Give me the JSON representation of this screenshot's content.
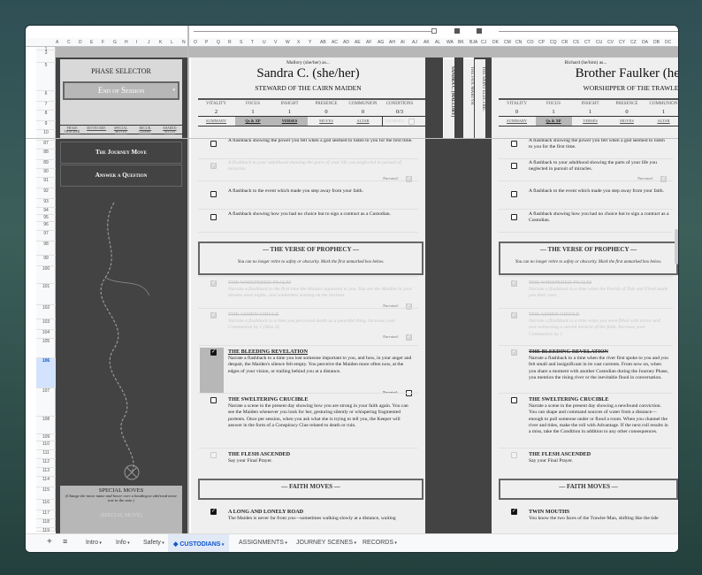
{
  "columns": [
    "A",
    "C",
    "D",
    "E",
    "F",
    "G",
    "H",
    "I",
    "J",
    "K",
    "L",
    "N",
    "O",
    "P",
    "Q",
    "R",
    "S",
    "T",
    "U",
    "V",
    "W",
    "X",
    "Y",
    "AB",
    "AC",
    "AD",
    "AE",
    "AF",
    "AG",
    "AH",
    "AI",
    "AJ",
    "AK",
    "AL",
    "WA",
    "BK",
    "BJA",
    "CJ",
    "DK",
    "CM",
    "CN",
    "CO",
    "CP",
    "CQ",
    "CR",
    "CS",
    "CT",
    "CU",
    "CV",
    "CY",
    "CZ",
    "DA",
    "DB",
    "DC"
  ],
  "rows": [
    "1",
    "3",
    "5",
    "6",
    "7",
    "8",
    "9",
    "10",
    "87",
    "88",
    "89",
    "90",
    "91",
    "92",
    "93",
    "94",
    "95",
    "96",
    "97",
    "98",
    "99",
    "100",
    "101",
    "102",
    "103",
    "104",
    "105",
    "106",
    "107",
    "108",
    "109",
    "110",
    "111",
    "112",
    "113",
    "114",
    "115",
    "116",
    "117",
    "118",
    "119"
  ],
  "left_panel": {
    "title": "PHASE SELECTOR",
    "phase": "End of Session",
    "nav": [
      "PHASE TRACKER",
      "MOVES REF.",
      "SPECIAL MOVES",
      "RECUR. CHARS.",
      "SHARED NOTES"
    ],
    "buttons": [
      "The Journey Move",
      "Answer a Question"
    ],
    "special_title": "SPECIAL MOVES",
    "special_note": "(Change the move name and hover over a heading to edit/read move text in the note.)",
    "special_placeholder": "(SPECIAL MOVE)"
  },
  "stat_labels": [
    "VITALITY",
    "FOCUS",
    "INSIGHT",
    "PRESENCE",
    "COMMUNION",
    "CONDITIONS"
  ],
  "tab_labels": [
    "SUMMARY",
    "Qs & XP",
    "VERSES",
    "MOVES",
    "ALTAR"
  ],
  "journey_label": "JOURNEY:",
  "narrated": "Narrated:",
  "sheet1": {
    "player": "Mallory (she/her) as...",
    "name": "Sandra C. (she/her)",
    "role": "STEWARD OF THE CAIRN MAIDEN",
    "stats": [
      "2",
      "1",
      "1",
      "0",
      "0",
      "0/3"
    ],
    "questions": [
      "A flashback showing the power you felt when a god seemed to listen to you for the first time.",
      "A flashback to your adulthood showing the parts of your life you neglected in pursuit of miracles.",
      "A flashback to the event which made you step away from your faith.",
      "A flashback showing how you had no choice but to sign a contract as a Custodian."
    ],
    "verse_title": "— THE VERSE OF PROPHECY —",
    "verse_sub": "You can no longer retire to safety or obscurity. Mark the first unmarked box below.",
    "verses": [
      {
        "title": "THE WHISPERED PSALM",
        "text": "Narrate a flashback to the first time the Maiden appeared to you. You see the Maiden in your dreams most nights, and sometimes waiting on the horizon."
      },
      {
        "title": "THE ASHEN CIRCLE",
        "text": "Narrate a flashback to a time you perceived death as a peaceful thing. Increase your Communion by 1 (Max 3)."
      },
      {
        "title": "THE BLEEDING REVELATION",
        "text": "Narrate a flashback to a time you lost someone important to you, and how, in your anger and despair, the Maiden's silence felt empty. You perceive the Maiden more often now, at the edges of your vision, or trailing behind you at a distance."
      },
      {
        "title": "THE SWELTERING CRUCIBLE",
        "text": "Narrate a scene in the present day showing how you are strong in your faith again. You can see the Maiden whenever you look for her, gesturing silently or whispering fragmented portents. Once per session, when you ask what she is trying to tell you, the Keeper will answer in the form of a Conspiracy Clue related to death or ruin."
      },
      {
        "title": "THE FLESH ASCENDED",
        "text": "Say your Final Prayer."
      }
    ],
    "faith_title": "— FAITH MOVES —",
    "faith_move": {
      "title": "A LONG AND LONELY ROAD",
      "text": "The Maiden is never far from you—sometimes walking slowly at a distance, waiting"
    }
  },
  "vertical_tabs": [
    "SANDRA C. (MALLORY)",
    "THE FOX MARTYR",
    "THE SAINT ELECTRIC"
  ],
  "sheet2": {
    "player": "Richard (he/him) as...",
    "name": "Brother Faulker (he/him)",
    "role": "WORSHIPPER OF THE TRAWLER-MAN",
    "stats": [
      "0",
      "1",
      "1",
      "0",
      "1"
    ],
    "questions": [
      "A flashback showing the power you felt when a god seemed to listen to you for the first time.",
      "A flashback to your adulthood showing the parts of your life you neglected in pursuit of miracles.",
      "A flashback to the event which made you step away from your faith.",
      "A flashback showing how you had no choice but to sign a contract as a Custodian."
    ],
    "verse_title": "— THE VERSE OF PROPHECY —",
    "verse_sub": "You can no longer retire to safety or obscurity. Mark the first unmarked box below.",
    "verses": [
      {
        "title": "THE WHISPERED PSALM",
        "text": "Narrate a flashback to a time when the Parish of Tide and Flesh made you their own."
      },
      {
        "title": "THE ASHEN CIRCLE",
        "text": "Narrate a flashback to a time when you were filled with terror and awe witnessing a sacred miracle of the faith. Increase your Communion by 1."
      },
      {
        "title": "THE BLEEDING REVELATION",
        "text": "Narrate a flashback to a time when the river first spoke to you and you felt small and insignificant in its vast currents. From now on, when you share a moment with another Custodian during the Journey Phase, you mention the rising river or the inevitable flood in conversation."
      },
      {
        "title": "THE SWELTERING CRUCIBLE",
        "text": "Narrate a scene in the present day showing a newfound conviction. You can shape and command sources of water from a distance—enough to pull someone under or flood a room. When you channel the river and tides, make the roll with Advantage. If the next roll results in a miss, take the Condition in addition to any other consequences."
      },
      {
        "title": "THE FLESH ASCENDED",
        "text": "Say your Final Prayer."
      }
    ],
    "faith_title": "— FAITH MOVES —",
    "faith_move": {
      "title": "TWIN MOUTHS",
      "text": "You know the two faces of the Trawler-Man, shifting like the tide"
    }
  },
  "sheet_tabs": [
    "Intro",
    "Info",
    "Safety",
    "CUSTODIANS",
    "ASSIGNMENTS",
    "JOURNEY SCENES",
    "RECORDS"
  ],
  "colors": {
    "active_tab": "#0b57d0",
    "panel_dark": "#434343",
    "panel_gray": "#b7b7b7",
    "sheet_bg": "#efefef"
  }
}
